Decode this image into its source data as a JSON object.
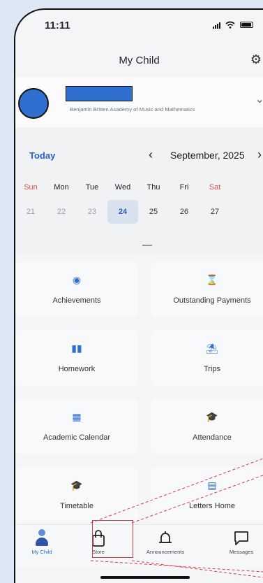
{
  "status_bar": {
    "time": "11:11"
  },
  "header": {
    "title": "My Child"
  },
  "child": {
    "school": "Benjamin Britten Academy of Music and Mathematics"
  },
  "calendar": {
    "today_label": "Today",
    "month": "September, 2025",
    "weekdays": [
      "Sun",
      "Mon",
      "Tue",
      "Wed",
      "Thu",
      "Fri",
      "Sat"
    ],
    "dates": [
      "21",
      "22",
      "23",
      "24",
      "25",
      "26",
      "27"
    ],
    "selected_date": "24"
  },
  "tiles": [
    {
      "label": "Achievements",
      "icon": "medal-icon"
    },
    {
      "label": "Outstanding Payments",
      "icon": "hourglass-icon"
    },
    {
      "label": "Homework",
      "icon": "book-icon"
    },
    {
      "label": "Trips",
      "icon": "palm-tree-icon"
    },
    {
      "label": "Academic Calendar",
      "icon": "calendar-icon"
    },
    {
      "label": "Attendance",
      "icon": "graduate-icon"
    },
    {
      "label": "Timetable",
      "icon": "graduate-icon"
    },
    {
      "label": "Letters Home",
      "icon": "document-icon"
    }
  ],
  "tabbar": {
    "my_child": "My Child",
    "store": "Store",
    "announcements": "Announcements",
    "messages": "Messages"
  },
  "colors": {
    "accent": "#2f6fcf",
    "weekend": "#d9534f",
    "highlight_box": "#d03a4a"
  }
}
